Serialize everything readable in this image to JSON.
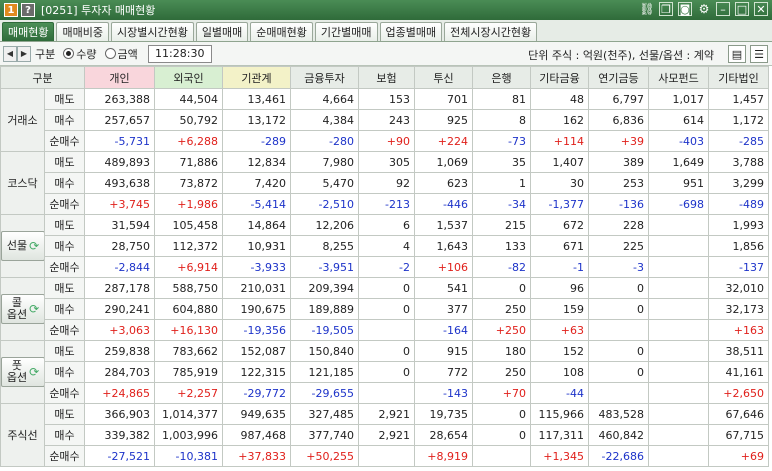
{
  "window": {
    "num1": "1",
    "num2": "?",
    "title": "[0251] 투자자 매매현황",
    "icons": [
      "link-icon",
      "copy-icon",
      "camera-icon",
      "gear-icon",
      "minimize-icon",
      "maximize-icon",
      "close-icon"
    ]
  },
  "tabs": [
    {
      "label": "매매현황",
      "active": true
    },
    {
      "label": "매매비중",
      "active": false
    },
    {
      "label": "시장별시간현황",
      "active": false
    },
    {
      "label": "일별매매",
      "active": false
    },
    {
      "label": "순매매현황",
      "active": false
    },
    {
      "label": "기간별매매",
      "active": false
    },
    {
      "label": "업종별매매",
      "active": false
    },
    {
      "label": "전체시장시간현황",
      "active": false
    }
  ],
  "options": {
    "label": "구분",
    "radio_qty": "수량",
    "radio_amt": "금액",
    "selected": "수량",
    "time": "11:28:30",
    "unit": "단위 주식 : 억원(천주), 선물/옵션 : 계약"
  },
  "columns": [
    "구분",
    "",
    "개인",
    "외국인",
    "기관계",
    "금융투자",
    "보험",
    "투신",
    "은행",
    "기타금융",
    "연기금등",
    "사모펀드",
    "기타법인"
  ],
  "row_labels": [
    "매도",
    "매수",
    "순매수"
  ],
  "markets": [
    {
      "name": "거래소",
      "is_button": false,
      "rows": [
        [
          "263,388",
          "44,504",
          "13,461",
          "4,664",
          "153",
          "701",
          "81",
          "48",
          "6,797",
          "1,017",
          "1,457"
        ],
        [
          "257,657",
          "50,792",
          "13,172",
          "4,384",
          "243",
          "925",
          "8",
          "162",
          "6,836",
          "614",
          "1,172"
        ],
        [
          "-5,731",
          "+6,288",
          "-289",
          "-280",
          "+90",
          "+224",
          "-73",
          "+114",
          "+39",
          "-403",
          "-285"
        ]
      ]
    },
    {
      "name": "코스닥",
      "is_button": false,
      "rows": [
        [
          "489,893",
          "71,886",
          "12,834",
          "7,980",
          "305",
          "1,069",
          "35",
          "1,407",
          "389",
          "1,649",
          "3,788"
        ],
        [
          "493,638",
          "73,872",
          "7,420",
          "5,470",
          "92",
          "623",
          "1",
          "30",
          "253",
          "951",
          "3,299"
        ],
        [
          "+3,745",
          "+1,986",
          "-5,414",
          "-2,510",
          "-213",
          "-446",
          "-34",
          "-1,377",
          "-136",
          "-698",
          "-489"
        ]
      ]
    },
    {
      "name": "선물",
      "is_button": true,
      "rows": [
        [
          "31,594",
          "105,458",
          "14,864",
          "12,206",
          "6",
          "1,537",
          "215",
          "672",
          "228",
          "",
          "1,993"
        ],
        [
          "28,750",
          "112,372",
          "10,931",
          "8,255",
          "4",
          "1,643",
          "133",
          "671",
          "225",
          "",
          "1,856"
        ],
        [
          "-2,844",
          "+6,914",
          "-3,933",
          "-3,951",
          "-2",
          "+106",
          "-82",
          "-1",
          "-3",
          "",
          "-137"
        ]
      ]
    },
    {
      "name": "콜\n옵션",
      "is_button": true,
      "rows": [
        [
          "287,178",
          "588,750",
          "210,031",
          "209,394",
          "0",
          "541",
          "0",
          "96",
          "0",
          "",
          "32,010"
        ],
        [
          "290,241",
          "604,880",
          "190,675",
          "189,889",
          "0",
          "377",
          "250",
          "159",
          "0",
          "",
          "32,173"
        ],
        [
          "+3,063",
          "+16,130",
          "-19,356",
          "-19,505",
          "",
          "-164",
          "+250",
          "+63",
          "",
          "",
          "+163"
        ]
      ]
    },
    {
      "name": "풋\n옵션",
      "is_button": true,
      "rows": [
        [
          "259,838",
          "783,662",
          "152,087",
          "150,840",
          "0",
          "915",
          "180",
          "152",
          "0",
          "",
          "38,511"
        ],
        [
          "284,703",
          "785,919",
          "122,315",
          "121,185",
          "0",
          "772",
          "250",
          "108",
          "0",
          "",
          "41,161"
        ],
        [
          "+24,865",
          "+2,257",
          "-29,772",
          "-29,655",
          "",
          "-143",
          "+70",
          "-44",
          "",
          "",
          "+2,650"
        ]
      ]
    },
    {
      "name": "주식선",
      "is_button": false,
      "rows": [
        [
          "366,903",
          "1,014,377",
          "949,635",
          "327,485",
          "2,921",
          "19,735",
          "0",
          "115,966",
          "483,528",
          "",
          "67,646"
        ],
        [
          "339,382",
          "1,003,996",
          "987,468",
          "377,740",
          "2,921",
          "28,654",
          "0",
          "117,311",
          "460,842",
          "",
          "67,715"
        ],
        [
          "-27,521",
          "-10,381",
          "+37,833",
          "+50,255",
          "",
          "+8,919",
          "",
          "+1,345",
          "-22,686",
          "",
          "+69"
        ]
      ]
    }
  ],
  "colors": {
    "positive": "#e0201b",
    "negative": "#1d33c9",
    "title_bar": "#2f6b3a",
    "personal_header": "#f9d6dc",
    "foreign_header": "#d8efd2",
    "inst_header": "#f3f2c8"
  }
}
